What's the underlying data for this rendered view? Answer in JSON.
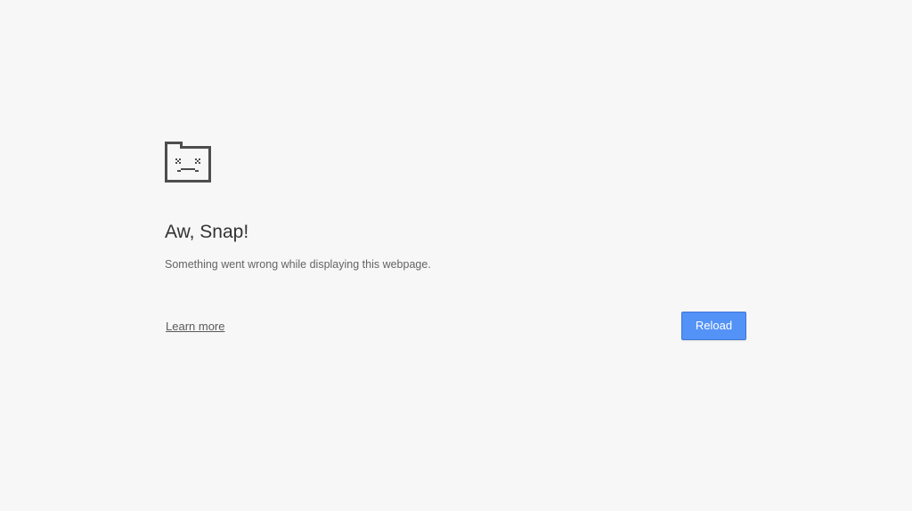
{
  "error": {
    "icon": "sad-tab-icon",
    "title": "Aw, Snap!",
    "message": "Something went wrong while displaying this webpage."
  },
  "actions": {
    "learn_more_label": "Learn more",
    "reload_label": "Reload"
  },
  "colors": {
    "background": "#f7f7f7",
    "title": "#333333",
    "message": "#646464",
    "link": "#5a5a5a",
    "button": "#5392f7",
    "button_border": "#3a77d8",
    "icon": "#4d4d4d"
  }
}
